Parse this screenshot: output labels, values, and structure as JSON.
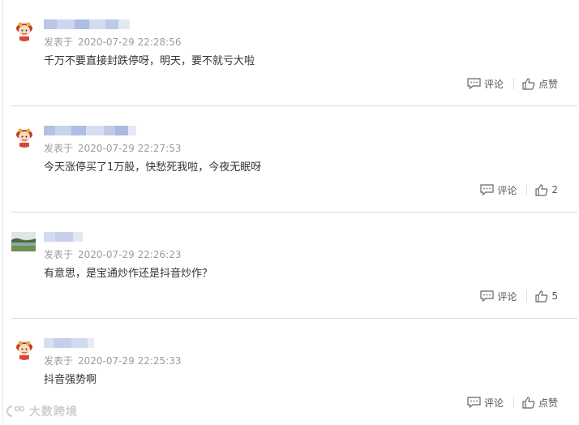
{
  "comments": [
    {
      "meta_prefix": "发表于",
      "time": "2020-07-29 22:28:56",
      "content": "千万不要直接封跌停呀，明天，要不就亏大啦",
      "reply_label": "评论",
      "like_label": "点赞",
      "avatar_icon": "cartoon-avatar-icon"
    },
    {
      "meta_prefix": "发表于",
      "time": "2020-07-29 22:27:53",
      "content": "今天涨停买了1万股，快愁死我啦，今夜无眠呀",
      "reply_label": "评论",
      "like_label": "2",
      "avatar_icon": "cartoon-avatar-icon"
    },
    {
      "meta_prefix": "发表于",
      "time": "2020-07-29 22:26:23",
      "content": "有意思，是宝通炒作还是抖音炒作？",
      "reply_label": "评论",
      "like_label": "5",
      "avatar_icon": "landscape-avatar-icon"
    },
    {
      "meta_prefix": "发表于",
      "time": "2020-07-29 22:25:33",
      "content": "抖音强势啊",
      "reply_label": "评论",
      "like_label": "点赞",
      "avatar_icon": "cartoon-avatar-icon"
    }
  ],
  "watermark": "大数跨境",
  "colors": {
    "meta": "#9c9c9c",
    "content": "#333333",
    "divider": "#dcdcdc",
    "blur": "#c9d3ea"
  }
}
